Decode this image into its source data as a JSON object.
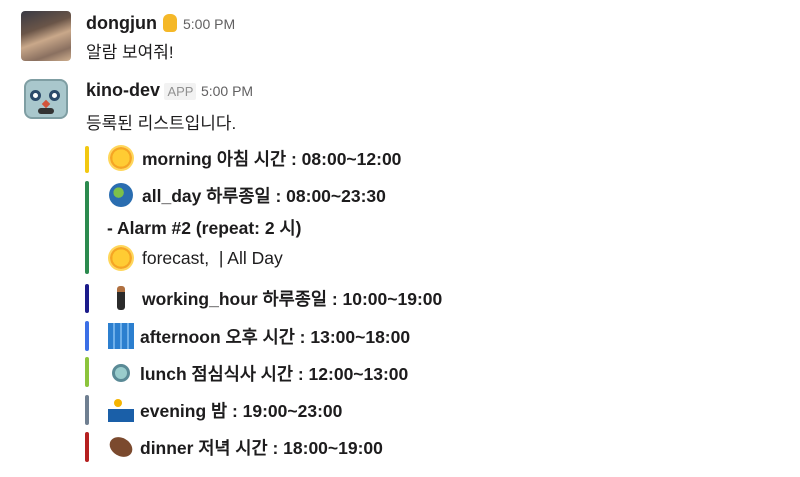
{
  "messages": [
    {
      "author": "dongjun",
      "status_emoji": "duck-icon",
      "time": "5:00 PM",
      "text": "알람 보여줘!"
    },
    {
      "author": "kino-dev",
      "badge": "APP",
      "time": "5:00 PM",
      "text": "등록된 리스트입니다."
    }
  ],
  "attachments": [
    {
      "color": "#f2c811",
      "icon": "sun-icon",
      "label": "morning 아침 시간 : 08:00~12:00"
    },
    {
      "color": "#2b8a4e",
      "icon": "globe-icon",
      "label": "all_day 하루종일 : 08:00~23:30",
      "extra": "- Alarm #2 (repeat: 2 시)",
      "forecast": "forecast,  | All Day"
    },
    {
      "color": "#1b1b8a",
      "icon": "man-in-suit-icon",
      "label": "working_hour 하루종일 : 10:00~19:00"
    },
    {
      "color": "#3b6fe6",
      "icon": "cityscape-icon",
      "label": "afternoon 오후 시간 : 13:00~18:00"
    },
    {
      "color": "#8cc43c",
      "icon": "fork-knife-plate-icon",
      "label": "lunch 점심식사 시간 : 12:00~13:00"
    },
    {
      "color": "#6f7f91",
      "icon": "night-city-icon",
      "label": "evening 밤 : 19:00~23:00"
    },
    {
      "color": "#b52020",
      "icon": "meat-icon",
      "label": "dinner 저녁 시간 : 18:00~19:00"
    }
  ]
}
